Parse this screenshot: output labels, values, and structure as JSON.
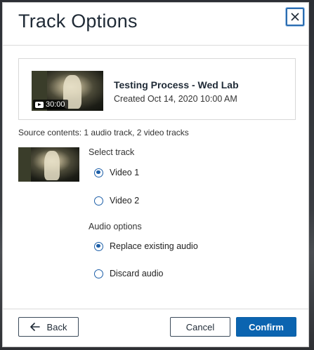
{
  "dialog": {
    "title": "Track Options",
    "close_icon": "close-icon"
  },
  "session": {
    "title": "Testing Process - Wed Lab",
    "created": "Created Oct 14, 2020 10:00 AM",
    "duration": "30:00",
    "duration_icon": "play-icon"
  },
  "source_contents": "Source contents: 1 audio track, 2 video tracks",
  "select_track": {
    "label": "Select track",
    "options": [
      {
        "label": "Video 1",
        "checked": true
      },
      {
        "label": "Video 2",
        "checked": false
      }
    ]
  },
  "audio_options": {
    "label": "Audio options",
    "options": [
      {
        "label": "Replace existing audio",
        "checked": true
      },
      {
        "label": "Discard audio",
        "checked": false
      }
    ]
  },
  "footer": {
    "back_label": "Back",
    "back_icon": "arrow-left-icon",
    "cancel_label": "Cancel",
    "confirm_label": "Confirm"
  },
  "colors": {
    "accent": "#0b64b0",
    "title_text": "#1f2a36"
  }
}
